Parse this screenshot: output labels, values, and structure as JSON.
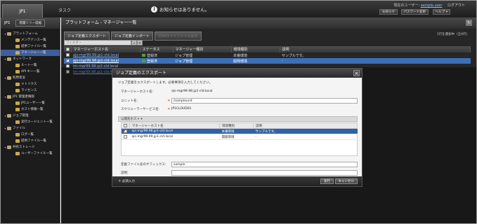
{
  "topbar": {
    "tab_active": "JP1",
    "tab_inactive": "タスク",
    "notice": "お知らせはありません。",
    "user_prefix": "現在のユーザー:",
    "user_name": "sample.user",
    "logout": "ログアウト",
    "btn_notice": "お知らせ",
    "btn_password": "パスワード変更",
    "btn_help": "ヘルプ ▾"
  },
  "sidebar": {
    "title": "JP1",
    "collapse_button": "階層ツリー収縮",
    "items": [
      {
        "label": "プラットフォーム",
        "level": 0,
        "expander": "▾"
      },
      {
        "label": "メンテナンス一覧",
        "level": 1
      },
      {
        "label": "提供ファイル一覧",
        "level": 1
      },
      {
        "label": "マネージャー一覧",
        "level": 1,
        "selected": true
      },
      {
        "label": "ネットワーク",
        "level": 0,
        "expander": "▾"
      },
      {
        "label": "ルート一覧",
        "level": 1
      },
      {
        "label": "API キー一覧",
        "level": 1
      },
      {
        "label": "利用状況",
        "level": 0,
        "expander": "▾"
      },
      {
        "label": "メトリクス",
        "level": 1
      },
      {
        "label": "ライセンス",
        "level": 1
      },
      {
        "label": "JP1 管理者権限",
        "level": 0,
        "expander": "▾"
      },
      {
        "label": "JP1ユーザー一覧",
        "level": 1
      },
      {
        "label": "ホスト情報一覧",
        "level": 1
      },
      {
        "label": "ジョブ管理",
        "level": 0,
        "expander": "▾"
      },
      {
        "label": "実行エージェント一覧",
        "level": 1
      },
      {
        "label": "ファイル",
        "level": 0,
        "expander": "▾"
      },
      {
        "label": "ログ一覧",
        "level": 1
      },
      {
        "label": "提供ファイル一覧",
        "level": 1
      },
      {
        "label": "共有ストレージ",
        "level": 0,
        "expander": "▾"
      },
      {
        "label": "ユーザーファイル一覧",
        "level": 1
      }
    ]
  },
  "main": {
    "title": "プラットフォーム - マネージャー一覧",
    "toolbar": [
      "ジョブ定義エクスポート",
      "ジョブ定義インポート",
      "ITDAサイドファイル設定"
    ],
    "count_text": "1行を選択中（全4行）",
    "filter_placeholder": "フィルター",
    "columns": [
      "マネージャーホスト名",
      "ステータス",
      "マネージャー種別",
      "環境種別",
      "説明"
    ],
    "rows": [
      {
        "host": "ajs-mgr99.99.jp1-cld.local",
        "status": "登録済",
        "type": "ジョブ管理",
        "env": "本番環境",
        "desc": "サンプルです。",
        "selected": false
      },
      {
        "host": "ajs-mgr99.98.jp1-cld.local",
        "status": "登録済",
        "type": "ジョブ管理",
        "env": "開発環境",
        "desc": "-",
        "selected": true
      },
      {
        "host": "im-mgr99.99.jp1-cld.local",
        "status": "",
        "type": "",
        "env": "",
        "desc": "",
        "selected": false
      },
      {
        "host": "im-mgr99.98.jp1-cld.local",
        "status": "",
        "type": "",
        "env": "",
        "desc": "",
        "selected": false
      }
    ]
  },
  "modal": {
    "title": "ジョブ定義のエクスポート",
    "description": "ジョブ定義をエクスポートします。必要事項を入力してください。",
    "host_label": "マネージャーホスト名:",
    "host_value": "ajs-mgr99.98.jp1-cld.local",
    "unit_label": "ユニット名:",
    "unit_value": "/sampleunit",
    "service_label": "スケジューラーサービス名:",
    "service_value": "JP1CLOUD01",
    "section_title": "公開先ホスト ▾",
    "columns": [
      "マネージャーホスト名",
      "環境種別",
      "説明"
    ],
    "rows": [
      {
        "host": "ajs-mgr99.98.jp1-cld.local",
        "env": "本番環境",
        "desc": "サンプルです。",
        "selected": true
      },
      {
        "host": "ajs-mgr99.99.jp1-cld.local",
        "env": "開発環境",
        "desc": "-",
        "selected": false
      }
    ],
    "suffix_label": "定義ファイル名のサフィックス:",
    "suffix_value": "sample",
    "desc_label": "説明:",
    "desc_value": "",
    "required_note": "＊ 必須入力",
    "run_button": "実行",
    "cancel_button": "キャンセル"
  }
}
